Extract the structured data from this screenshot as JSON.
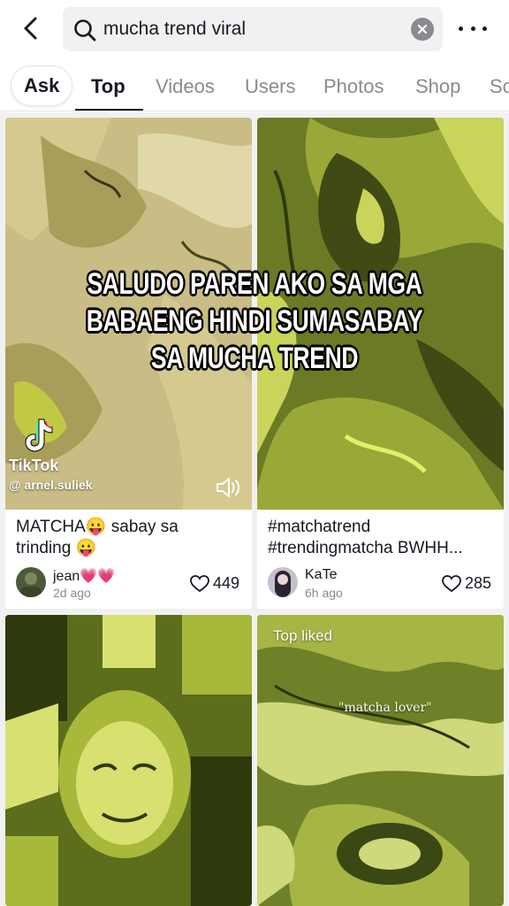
{
  "search": {
    "query": "mucha trend viral"
  },
  "tabs": [
    {
      "label": "Ask"
    },
    {
      "label": "Top"
    },
    {
      "label": "Videos"
    },
    {
      "label": "Users"
    },
    {
      "label": "Photos"
    },
    {
      "label": "Shop"
    },
    {
      "label": "So"
    }
  ],
  "overlay": {
    "line1": "SALUDO PAREN AKO SA MGA",
    "line2": "BABAENG HINDI SUMASABAY",
    "line3": "SA MUCHA TREND"
  },
  "watermark": {
    "brand": "TikTok",
    "handle": "@ arnel.suliek"
  },
  "results": [
    {
      "caption_line1": "MATCHA😛 sabay sa",
      "caption_line2": "trinding 😛",
      "username": "jean💗💗",
      "time": "2d ago",
      "likes": "449",
      "thumb_colors": [
        "#c9bd85",
        "#d6c990",
        "#a99d5a",
        "#e0d8a8"
      ]
    },
    {
      "caption_line1": "#matchatrend",
      "caption_line2": "#trendingmatcha BWHH...",
      "username": "KaTe",
      "time": "6h ago",
      "likes": "285",
      "thumb_colors": [
        "#6b7a24",
        "#9aa838",
        "#c9d45a",
        "#3f4a14"
      ]
    },
    {
      "badge": "",
      "thumb_colors": [
        "#5c6d1c",
        "#a8b83a",
        "#d8e070",
        "#2e3a0c"
      ]
    },
    {
      "badge": "Top liked",
      "overlay_quote": "\"matcha lover\"",
      "thumb_colors": [
        "#6f8128",
        "#a6b544",
        "#cfd87a",
        "#3a4814"
      ]
    }
  ],
  "colors": {
    "accent_text": "#161823",
    "muted_text": "#8a8b91",
    "search_bg": "#f1f1f2"
  }
}
